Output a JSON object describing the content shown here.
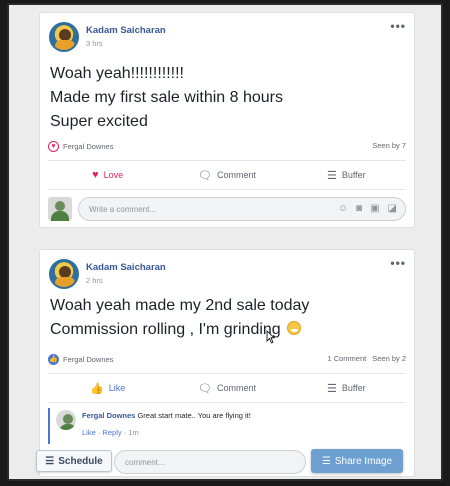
{
  "posts": [
    {
      "author": "Kadam Saicharan",
      "time": "3 hrs",
      "lines": [
        "Woah yeah!!!!!!!!!!!!",
        "Made my first sale within 8 hours",
        "Super excited"
      ],
      "reactor": "Fergal Downes",
      "seen": "Seen by 7",
      "actions": {
        "react": "Love",
        "comment": "Comment",
        "buffer": "Buffer"
      },
      "comment_placeholder": "Write a comment..."
    },
    {
      "author": "Kadam Saicharan",
      "time": "2 hrs",
      "lines": [
        "Woah yeah made my 2nd sale today",
        "Commission rolling , I'm grinding"
      ],
      "reactor": "Fergal Downes",
      "comments_count": "1 Comment",
      "seen": "Seen by 2",
      "actions": {
        "react": "Like",
        "comment": "Comment",
        "buffer": "Buffer"
      },
      "reply": {
        "author": "Fergal Downes",
        "text": "Great start mate.. You are flying it!",
        "like": "Like",
        "reply": "Reply",
        "time": "1m"
      },
      "comment_placeholder": "comment..."
    }
  ],
  "overlay": {
    "schedule_label": "Schedule",
    "share_label": "Share Image"
  },
  "colors": {
    "link_blue": "#365899",
    "love_red": "#e0245e",
    "like_blue": "#4a76d4",
    "share_button": "#6d9fd1"
  }
}
